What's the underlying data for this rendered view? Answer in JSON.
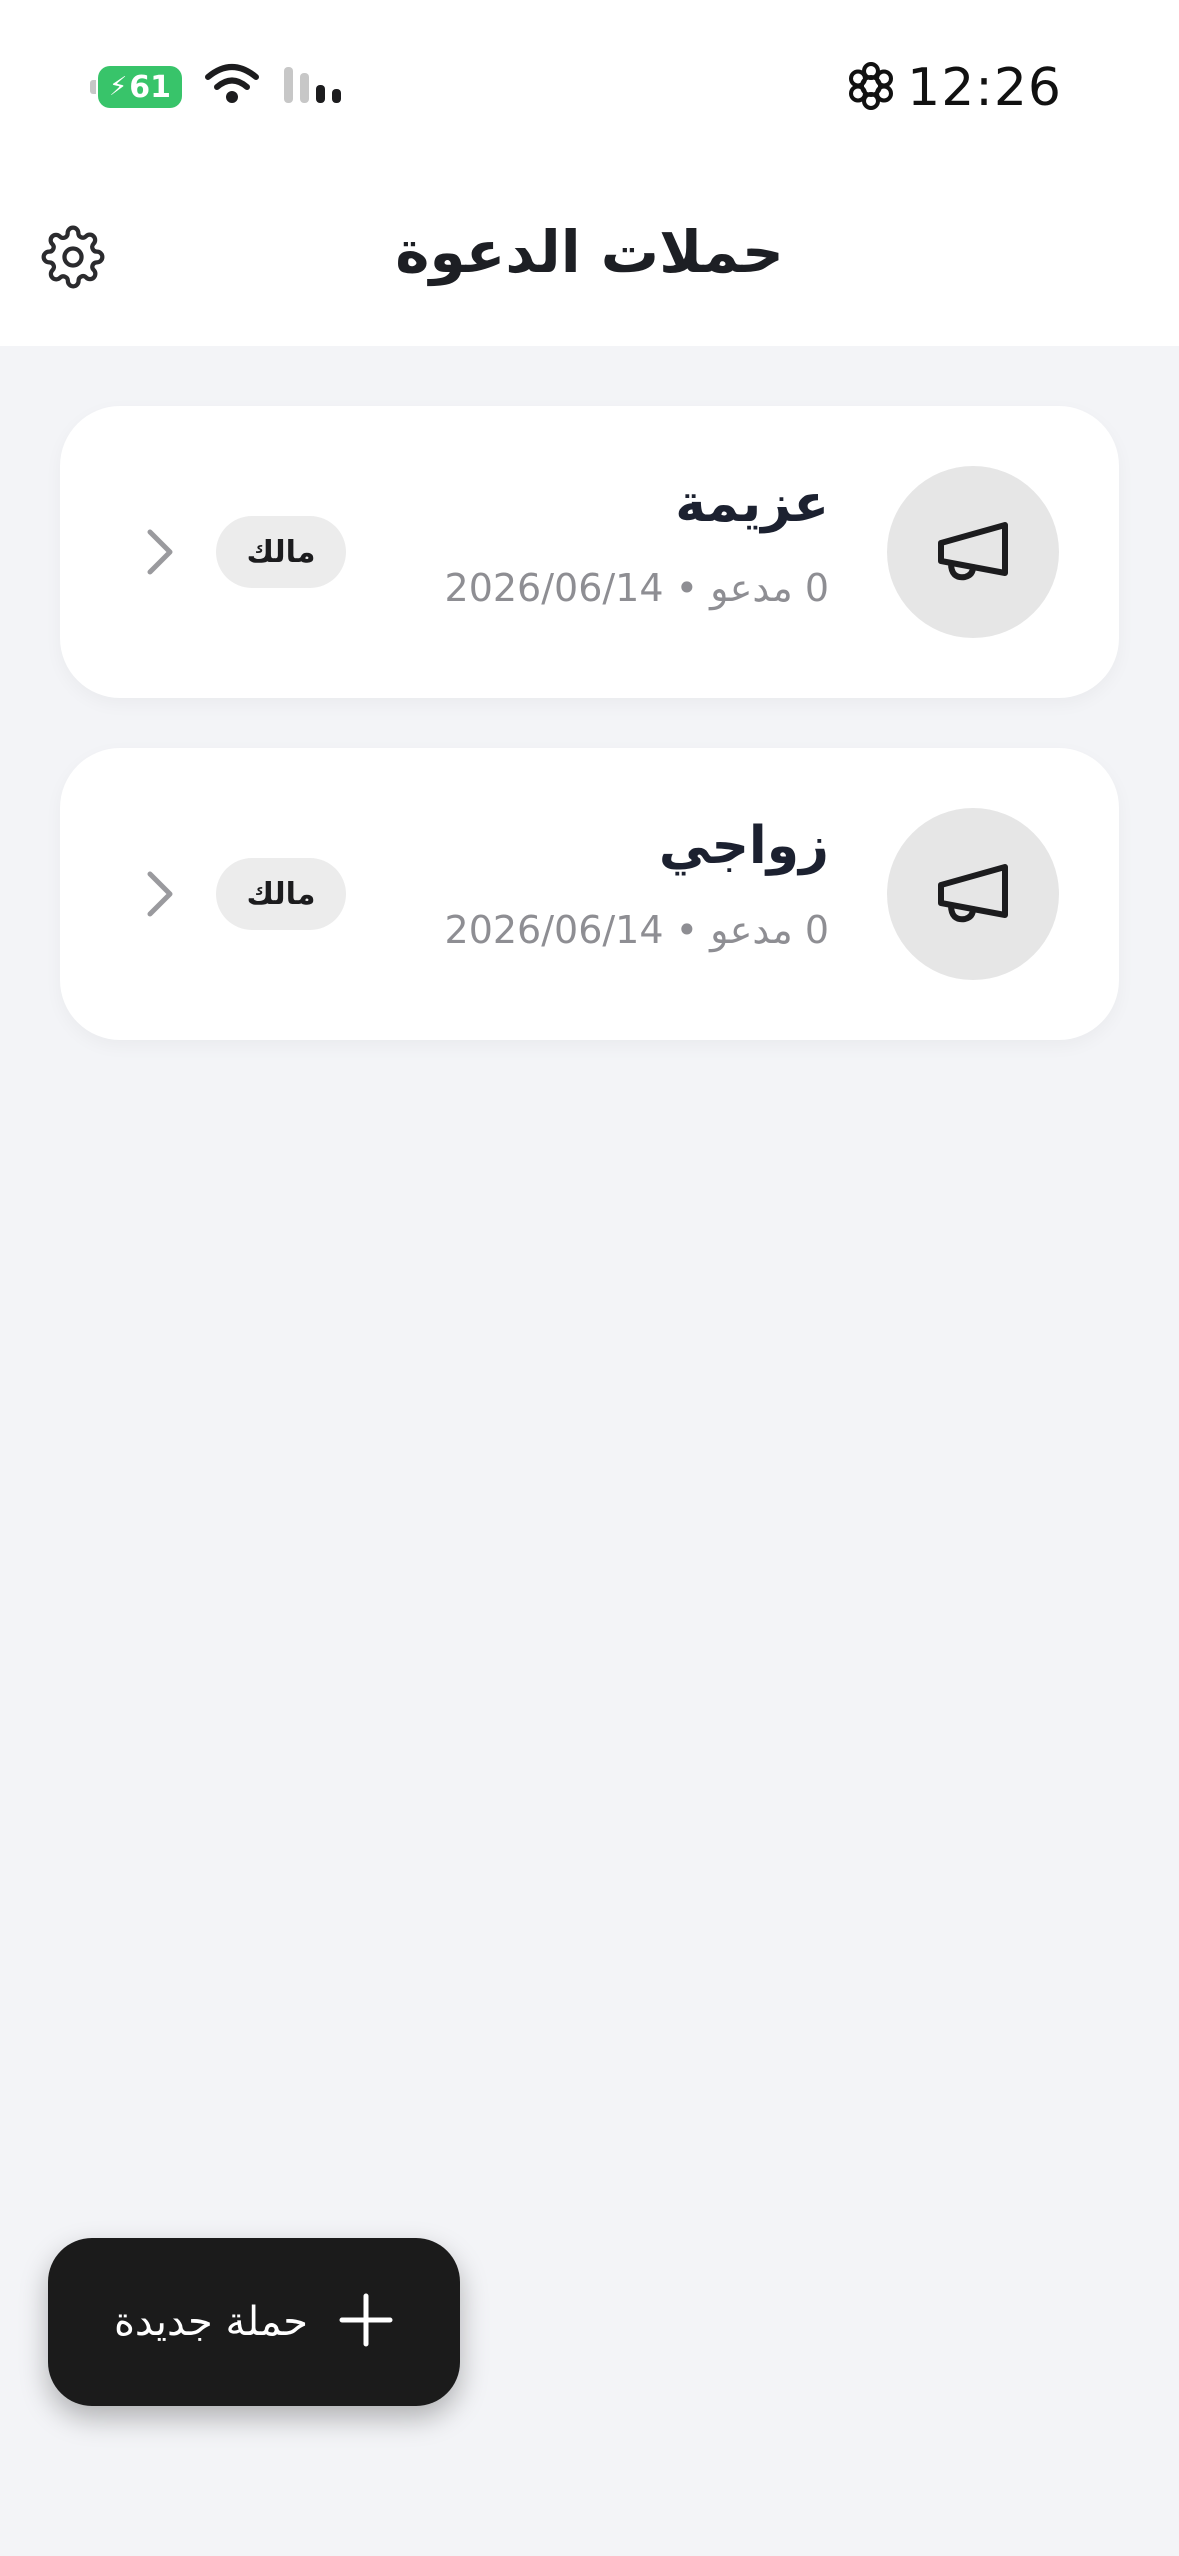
{
  "status_bar": {
    "time": "12:26",
    "battery_level": "61",
    "icons": [
      "battery-charging-icon",
      "wifi-icon",
      "signal-icon",
      "settings-status-icon"
    ]
  },
  "header": {
    "title": "حملات الدعوة",
    "settings_icon": "gear-icon"
  },
  "campaigns": [
    {
      "title": "عزيمة",
      "meta": "0 مدعو • 2026/06/14",
      "role": "مالك",
      "icon": "megaphone-icon"
    },
    {
      "title": "زواجي",
      "meta": "0 مدعو • 2026/06/14",
      "role": "مالك",
      "icon": "megaphone-icon"
    }
  ],
  "fab": {
    "label": "حملة جديدة",
    "icon": "plus-icon"
  },
  "colors": {
    "background": "#f3f4f7",
    "card": "#ffffff",
    "fab": "#1b1b1b",
    "battery": "#38c46a"
  }
}
